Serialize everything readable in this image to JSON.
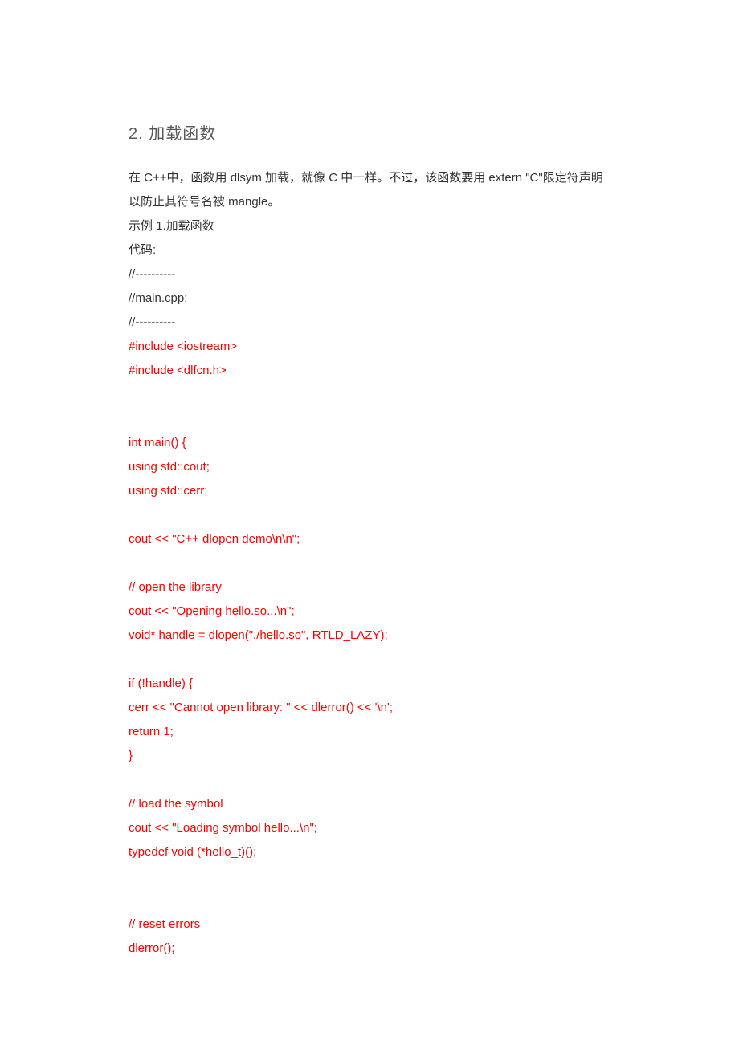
{
  "heading": "2.  加载函数",
  "intro": {
    "p1": "在 C++中，函数用 dlsym 加载，就像 C 中一样。不过，该函数要用 extern \"C\"限定符声明以防止其符号名被 mangle。",
    "p2": "示例 1.加载函数",
    "p3": "代码:",
    "p4": "//----------",
    "p5": "//main.cpp:",
    "p6": "//----------"
  },
  "code": {
    "l1": "#include <iostream>",
    "l2": "#include <dlfcn.h>",
    "l3": "int main() {",
    "l4": "using std::cout;",
    "l5": "using std::cerr;",
    "l6": "cout << \"C++ dlopen demo\\n\\n\";",
    "l7": "// open the library",
    "l8": "cout << \"Opening hello.so...\\n\";",
    "l9": "void* handle = dlopen(\"./hello.so\", RTLD_LAZY);",
    "l10": "if (!handle) {",
    "l11": "cerr << \"Cannot open library: \" << dlerror() << '\\n';",
    "l12": "return 1;",
    "l13": "}",
    "l14": "// load the symbol",
    "l15": "cout << \"Loading symbol hello...\\n\";",
    "l16": "typedef void (*hello_t)();",
    "l17": "// reset errors",
    "l18": "dlerror();"
  }
}
